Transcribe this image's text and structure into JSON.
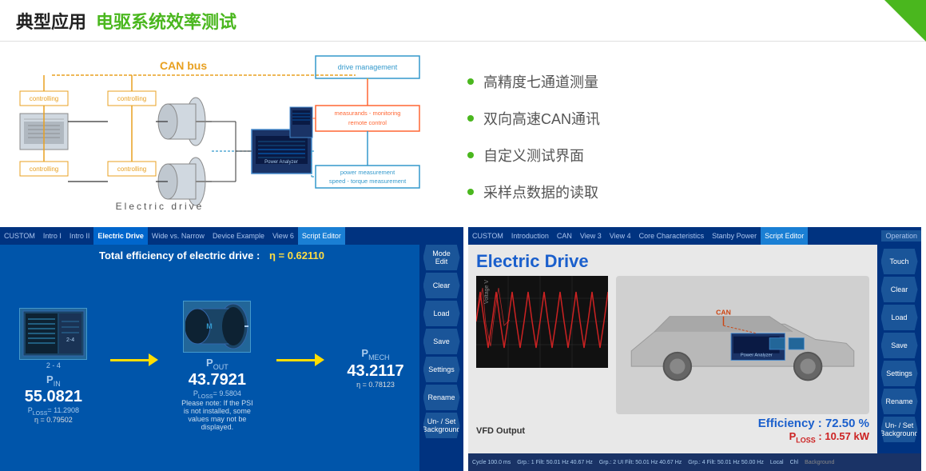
{
  "header": {
    "title_cn": "典型应用",
    "title_green": "电驱系统效率测试",
    "accent_color": "#4ab71e"
  },
  "diagram": {
    "can_bus_label": "CAN bus",
    "drive_management_label": "drive management",
    "measurements_label": "measurands - monitoring\nremote control",
    "power_measurement_label": "power measurement\nspeed - torque measurement",
    "electric_drive_label": "Electric  drive",
    "controlling_labels": [
      "controlling",
      "controlling",
      "controlling",
      "controlling"
    ]
  },
  "bullets": [
    "高精度七通道测量",
    "双向高速CAN通讯",
    "自定义测试界面",
    "采样点数据的读取"
  ],
  "left_panel": {
    "tabs": [
      "CUSTOM",
      "Intro I",
      "Intro II",
      "Electric Drive",
      "Wide vs. Narrow",
      "Device Example",
      "View 6",
      "Script Editor"
    ],
    "active_tab": "Electric Drive",
    "title": "Total efficiency of electric drive :",
    "formula": "η = 0.62110",
    "buttons": [
      "Mode\nEdit",
      "Clear",
      "Load",
      "Save",
      "Settings",
      "Rename",
      "Un- / Set\nBackground"
    ],
    "p_in_label": "P",
    "p_in_sub": "IN",
    "p_in_value": "55.0821",
    "p_loss1_label": "P",
    "p_loss1_sub": "LOSS",
    "p_loss1_value": "= 11.2908",
    "p_out_label": "P",
    "p_out_sub": "OUT",
    "p_out_value": "43.7921",
    "eta1_value": "η = 0.79502",
    "note_text": "Please note: If the PSI is not installed, some values may not be displayed.",
    "p_loss2_label": "P",
    "p_loss2_sub": "LOSS",
    "p_loss2_value": "= 9.5804",
    "eta2_value": "η = 0.78123",
    "p_mech_label": "P",
    "p_mech_sub": "MECH",
    "p_mech_value": "43.2117",
    "device_label": "2 - 4"
  },
  "right_panel": {
    "tabs": [
      "CUSTOM",
      "Introduction",
      "CAN",
      "View 3",
      "View 4",
      "Core Characteristics",
      "Stanby Power",
      "Script Editor"
    ],
    "active_tab": "Script Editor",
    "operation_tab": "Operation",
    "title": "Electric Drive",
    "buttons": [
      "Touch",
      "Clear",
      "Load",
      "Save",
      "Settings",
      "Rename",
      "Un- / Set\nBackground"
    ],
    "efficiency_label": "Efficiency : 72.50 %",
    "ploss_label": "P",
    "ploss_sub": "LOSS",
    "ploss_value": ": 10.57 kW",
    "vfd_label": "VFD Output",
    "can_label": "CAN",
    "bottom_bar": {
      "cycle": "Cycle  100.0  ms",
      "grp1": "Grp.: 1  Filt:  50.01  Hz  40.67  Hz",
      "grp2": "Grp.: 2 UI  Filt:  50.01  Hz  40.67  Hz",
      "grp3": "Grp.: 4 Filt:  50.01  Hz  50.00  Hz",
      "local": "Local",
      "chl": "Chl"
    }
  }
}
